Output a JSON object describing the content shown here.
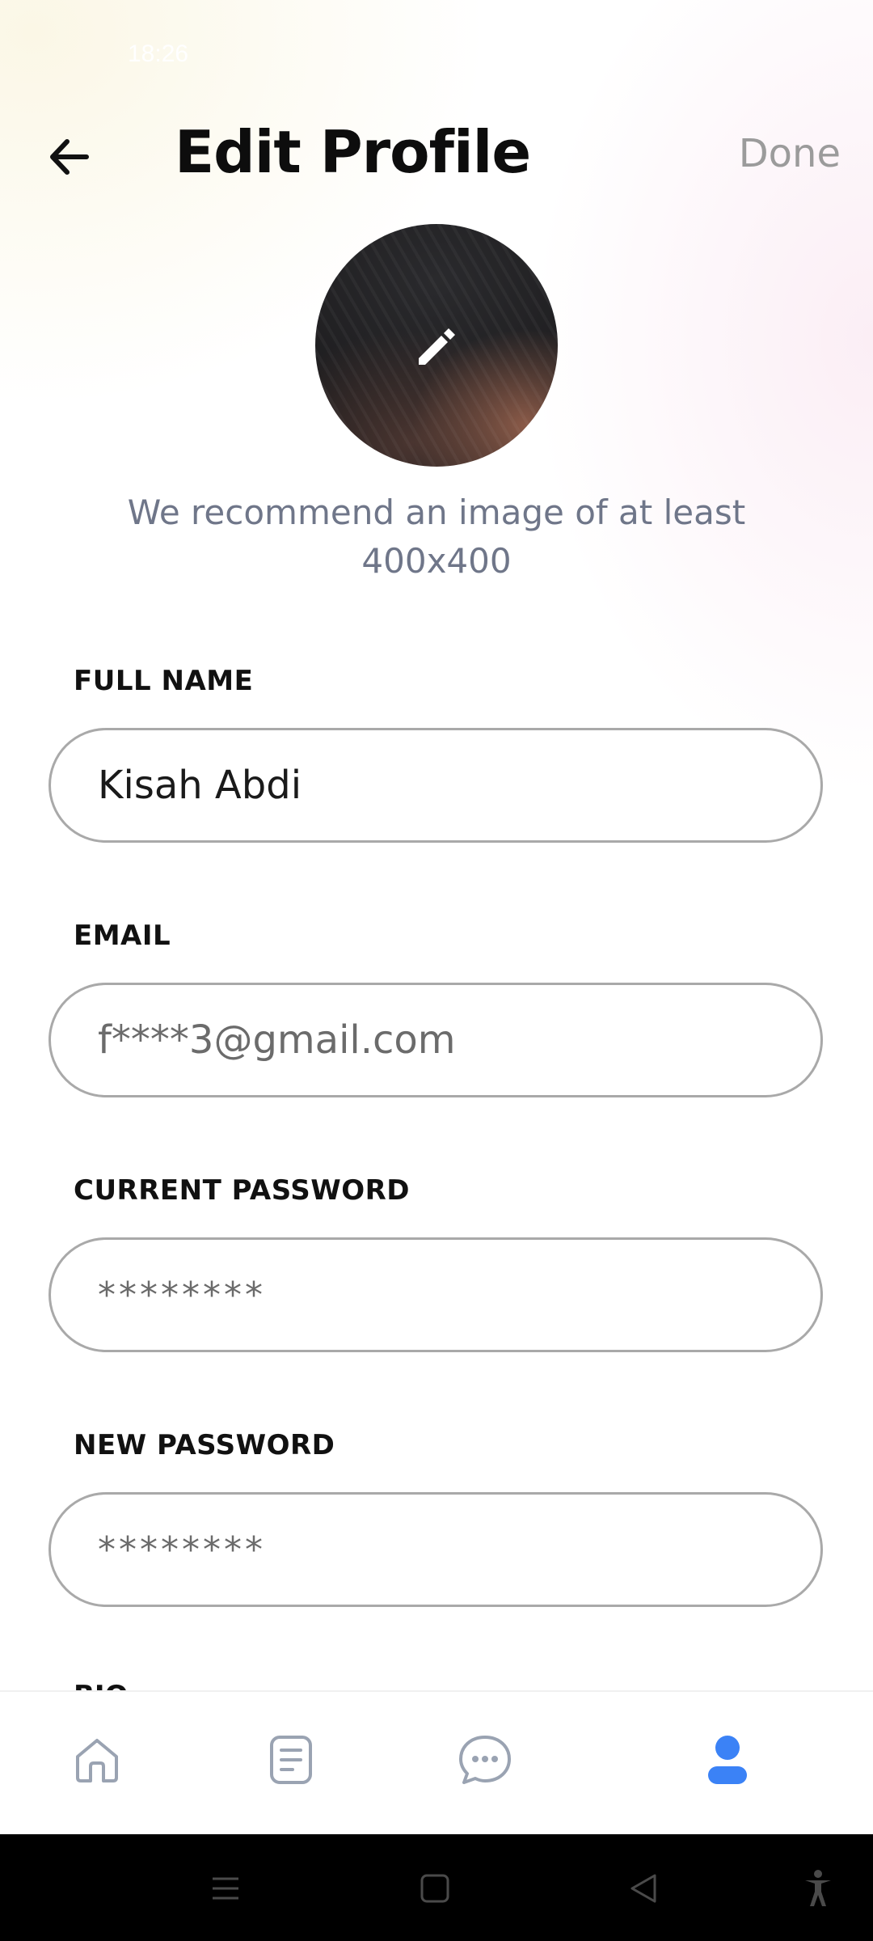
{
  "status_bar": {
    "time": "18:26"
  },
  "header": {
    "back_icon": "arrow-left-icon",
    "title": "Edit Profile",
    "done_label": "Done"
  },
  "avatar": {
    "edit_icon": "pencil-icon",
    "recommendation": "We recommend an image of at least 400x400"
  },
  "form": {
    "full_name": {
      "label": "FULL NAME",
      "value": "Kisah Abdi"
    },
    "email": {
      "label": "EMAIL",
      "value": "f****3@gmail.com"
    },
    "current_password": {
      "label": "CURRENT PASSWORD",
      "value": "********"
    },
    "new_password": {
      "label": "NEW PASSWORD",
      "value": "********"
    },
    "bio": {
      "label": "BIO"
    }
  },
  "bottom_nav": {
    "items": [
      {
        "icon": "home-icon",
        "active": false
      },
      {
        "icon": "document-icon",
        "active": false
      },
      {
        "icon": "chat-icon",
        "active": false
      },
      {
        "icon": "profile-icon",
        "active": true
      }
    ],
    "active_color": "#3b82f6",
    "inactive_color": "#9aa3b2"
  },
  "system_nav": {
    "items": [
      "menu-icon",
      "home-square-icon",
      "back-triangle-icon",
      "accessibility-icon"
    ]
  }
}
